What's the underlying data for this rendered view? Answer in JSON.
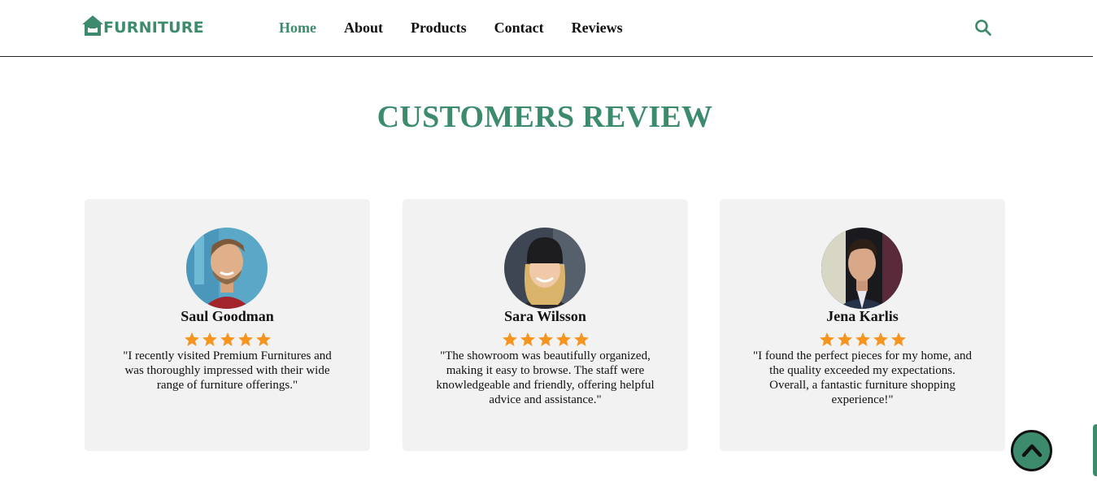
{
  "brand": {
    "name": "FURNITURE",
    "color": "#3d8b6d",
    "icon": "house-sofa-icon"
  },
  "nav": {
    "items": [
      {
        "label": "Home",
        "active": true
      },
      {
        "label": "About",
        "active": false
      },
      {
        "label": "Products",
        "active": false
      },
      {
        "label": "Contact",
        "active": false
      },
      {
        "label": "Reviews",
        "active": false
      }
    ],
    "search_icon": "search-icon"
  },
  "section": {
    "title": "CUSTOMERS REVIEW"
  },
  "reviews": [
    {
      "name": "Saul Goodman",
      "rating": 5,
      "quote": "\"I recently visited Premium Furnitures and was thoroughly impressed with their wide range of furniture offerings.\""
    },
    {
      "name": "Sara Wilsson",
      "rating": 5,
      "quote": "\"The showroom was beautifully organized, making it easy to browse. The staff were knowledgeable and friendly, offering helpful advice and assistance.\""
    },
    {
      "name": "Jena Karlis",
      "rating": 5,
      "quote": "\"I found the perfect pieces for my home, and the quality exceeded my expectations. Overall, a fantastic furniture shopping experience!\""
    }
  ],
  "colors": {
    "accent": "#3d8b6d",
    "star": "#f7941d",
    "card_bg": "#f2f2f2"
  },
  "scroll_top": {
    "icon": "chevron-up-icon"
  }
}
